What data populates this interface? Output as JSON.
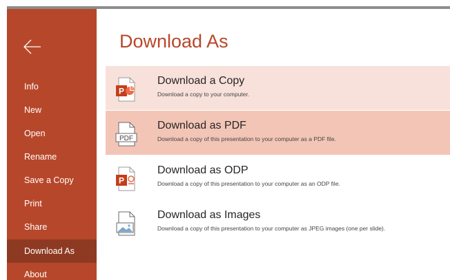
{
  "sidebar": {
    "items": [
      {
        "label": "Info"
      },
      {
        "label": "New"
      },
      {
        "label": "Open"
      },
      {
        "label": "Rename"
      },
      {
        "label": "Save a Copy"
      },
      {
        "label": "Print"
      },
      {
        "label": "Share"
      },
      {
        "label": "Download As"
      },
      {
        "label": "About"
      }
    ],
    "active_item": "Download As"
  },
  "main": {
    "title": "Download As",
    "options": [
      {
        "title": "Download a Copy",
        "description": "Download a copy to your computer.",
        "icon": "powerpoint-file-icon",
        "state": "hover"
      },
      {
        "title": "Download as PDF",
        "description": "Download a copy of this presentation to your computer as a PDF file.",
        "icon": "pdf-file-icon",
        "icon_text": "PDF",
        "state": "selected"
      },
      {
        "title": "Download as ODP",
        "description": "Download a copy of this presentation to your computer as an ODP file.",
        "icon": "odp-file-icon",
        "state": "normal"
      },
      {
        "title": "Download as Images",
        "description": "Download a copy of this presentation to your computer as JPEG images (one per slide).",
        "icon": "image-file-icon",
        "state": "normal"
      }
    ]
  },
  "colors": {
    "accent": "#b7472a",
    "sidebar_active": "#8e3a22",
    "option_hover": "#f8e1da",
    "option_selected": "#f3c5b6"
  }
}
